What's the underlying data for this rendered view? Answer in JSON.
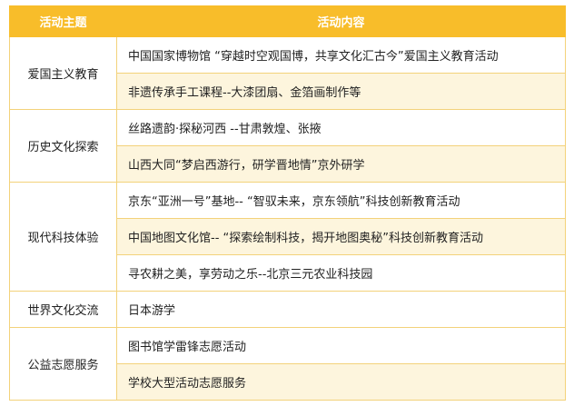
{
  "header": {
    "col_theme": "活动主题",
    "col_content": "活动内容"
  },
  "groups": [
    {
      "theme": "爱国主义教育",
      "items": [
        "中国国家博物馆 “穿越时空观国博，共享文化汇古今”爱国主义教育活动",
        "非遗传承手工课程--大漆团扇、金箔画制作等"
      ]
    },
    {
      "theme": "历史文化探索",
      "items": [
        "丝路遗韵·探秘河西 --甘肃敦煌、张掖",
        "山西大同“梦启西游行，研学晋地情”京外研学"
      ]
    },
    {
      "theme": "现代科技体验",
      "items": [
        "京东“亚洲一号”基地-- “智驭未来，京东领航”科技创新教育活动",
        "中国地图文化馆-- “探索绘制科技，揭开地图奥秘”科技创新教育活动",
        "寻农耕之美，享劳动之乐--北京三元农业科技园"
      ]
    },
    {
      "theme": "世界文化交流",
      "items": [
        "日本游学"
      ]
    },
    {
      "theme": "公益志愿服务",
      "items": [
        "图书馆学雷锋志愿活动",
        "学校大型活动志愿服务"
      ]
    }
  ],
  "colors": {
    "header_bg": "#f8bd2a",
    "header_text": "#ffffff",
    "border": "#f3d27a",
    "stripe": "#fdf5dd"
  }
}
